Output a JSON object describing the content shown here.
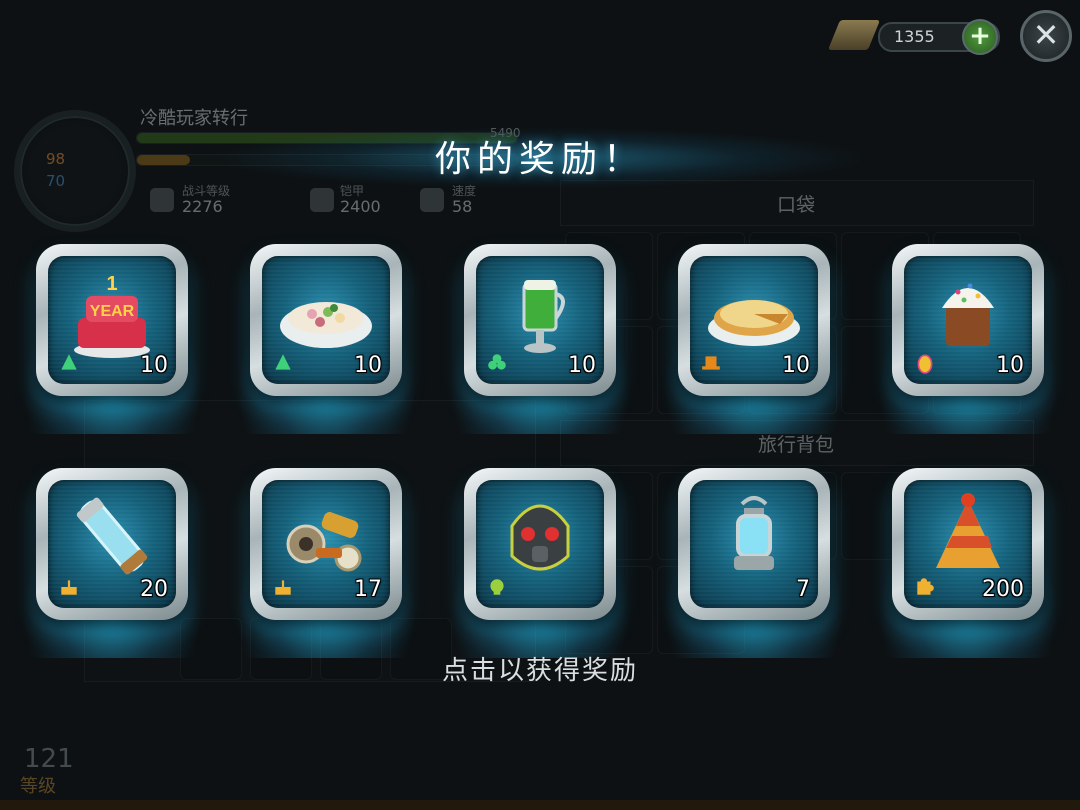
{
  "header": {
    "currency_value": "1355",
    "add_currency": "+",
    "close": "✕"
  },
  "player": {
    "name": "冷酷玩家转行",
    "health": "98",
    "water": "70",
    "xp_text": "5490"
  },
  "stats": [
    {
      "label": "战斗等级",
      "value": "2276"
    },
    {
      "label": "铠甲",
      "value": "2400"
    },
    {
      "label": "速度",
      "value": "58"
    }
  ],
  "sections": {
    "pocket": "口袋",
    "backpack": "旅行背包"
  },
  "level": {
    "number": "121",
    "label": "等级"
  },
  "rewards_panel": {
    "title": "你的奖励！",
    "hint": "点击以获得奖励",
    "items": [
      {
        "name": "anniversary-cake",
        "quantity": "10",
        "badge": "tree-icon",
        "cake_text": "YEAR",
        "cake_num": "1"
      },
      {
        "name": "olivier-salad",
        "quantity": "10",
        "badge": "tree-icon"
      },
      {
        "name": "green-beer-mug",
        "quantity": "10",
        "badge": "clover-icon"
      },
      {
        "name": "pumpkin-pie",
        "quantity": "10",
        "badge": "pilgrim-hat-icon"
      },
      {
        "name": "easter-kulich",
        "quantity": "10",
        "badge": "easter-egg-icon"
      },
      {
        "name": "energy-capsule",
        "quantity": "20",
        "badge": "birthday-cake-icon"
      },
      {
        "name": "scrap-parts",
        "quantity": "17",
        "badge": "birthday-cake-icon"
      },
      {
        "name": "gas-mask-helmet",
        "quantity": "",
        "badge": "skull-icon"
      },
      {
        "name": "lantern",
        "quantity": "7",
        "badge": ""
      },
      {
        "name": "party-hat",
        "quantity": "200",
        "badge": "puzzle-icon"
      }
    ]
  },
  "colors": {
    "glow": "#28d2ff",
    "inner": "#14607a",
    "frame": "#d6dee0"
  }
}
